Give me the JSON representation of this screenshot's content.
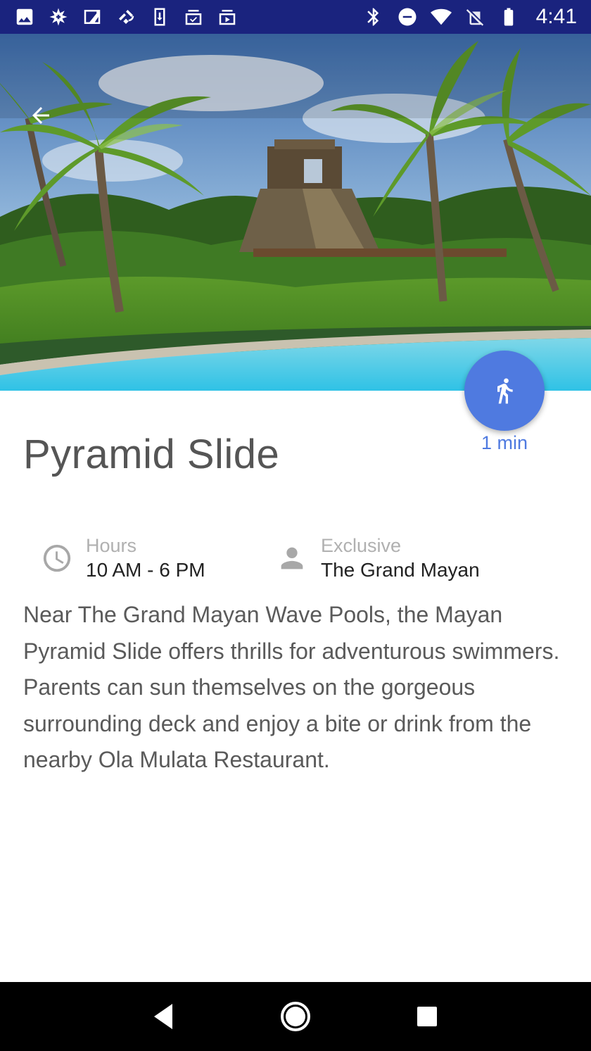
{
  "status_bar": {
    "time": "4:41",
    "left_icons": [
      "gallery-icon",
      "pinwheel-icon",
      "map-icon",
      "fake-gps-icon",
      "download-icon",
      "inbox-check-icon",
      "video-inbox-icon"
    ],
    "right_icons": [
      "bluetooth-icon",
      "do-not-disturb-icon",
      "wifi-icon",
      "no-sim-icon",
      "battery-icon"
    ],
    "background": "#1a237e"
  },
  "hero": {
    "icon_back": "arrow-left-icon"
  },
  "walk": {
    "icon": "walking-person-icon",
    "time": "1 min",
    "color": "#4f7ae0"
  },
  "title": "Pyramid Slide",
  "info": {
    "hours": {
      "icon": "clock-icon",
      "label": "Hours",
      "value": "10 AM - 6 PM"
    },
    "exclusive": {
      "icon": "person-icon",
      "label": "Exclusive",
      "value": "The Grand Mayan"
    }
  },
  "description": "Near The Grand Mayan Wave Pools, the Mayan Pyramid Slide offers thrills for adventurous swimmers. Parents can sun themselves on the gorgeous surrounding deck and enjoy a bite or drink from the nearby Ola Mulata Restaurant.",
  "nav": {
    "back_icon": "triangle-back-icon",
    "home_icon": "circle-home-icon",
    "recents_icon": "square-recents-icon"
  }
}
